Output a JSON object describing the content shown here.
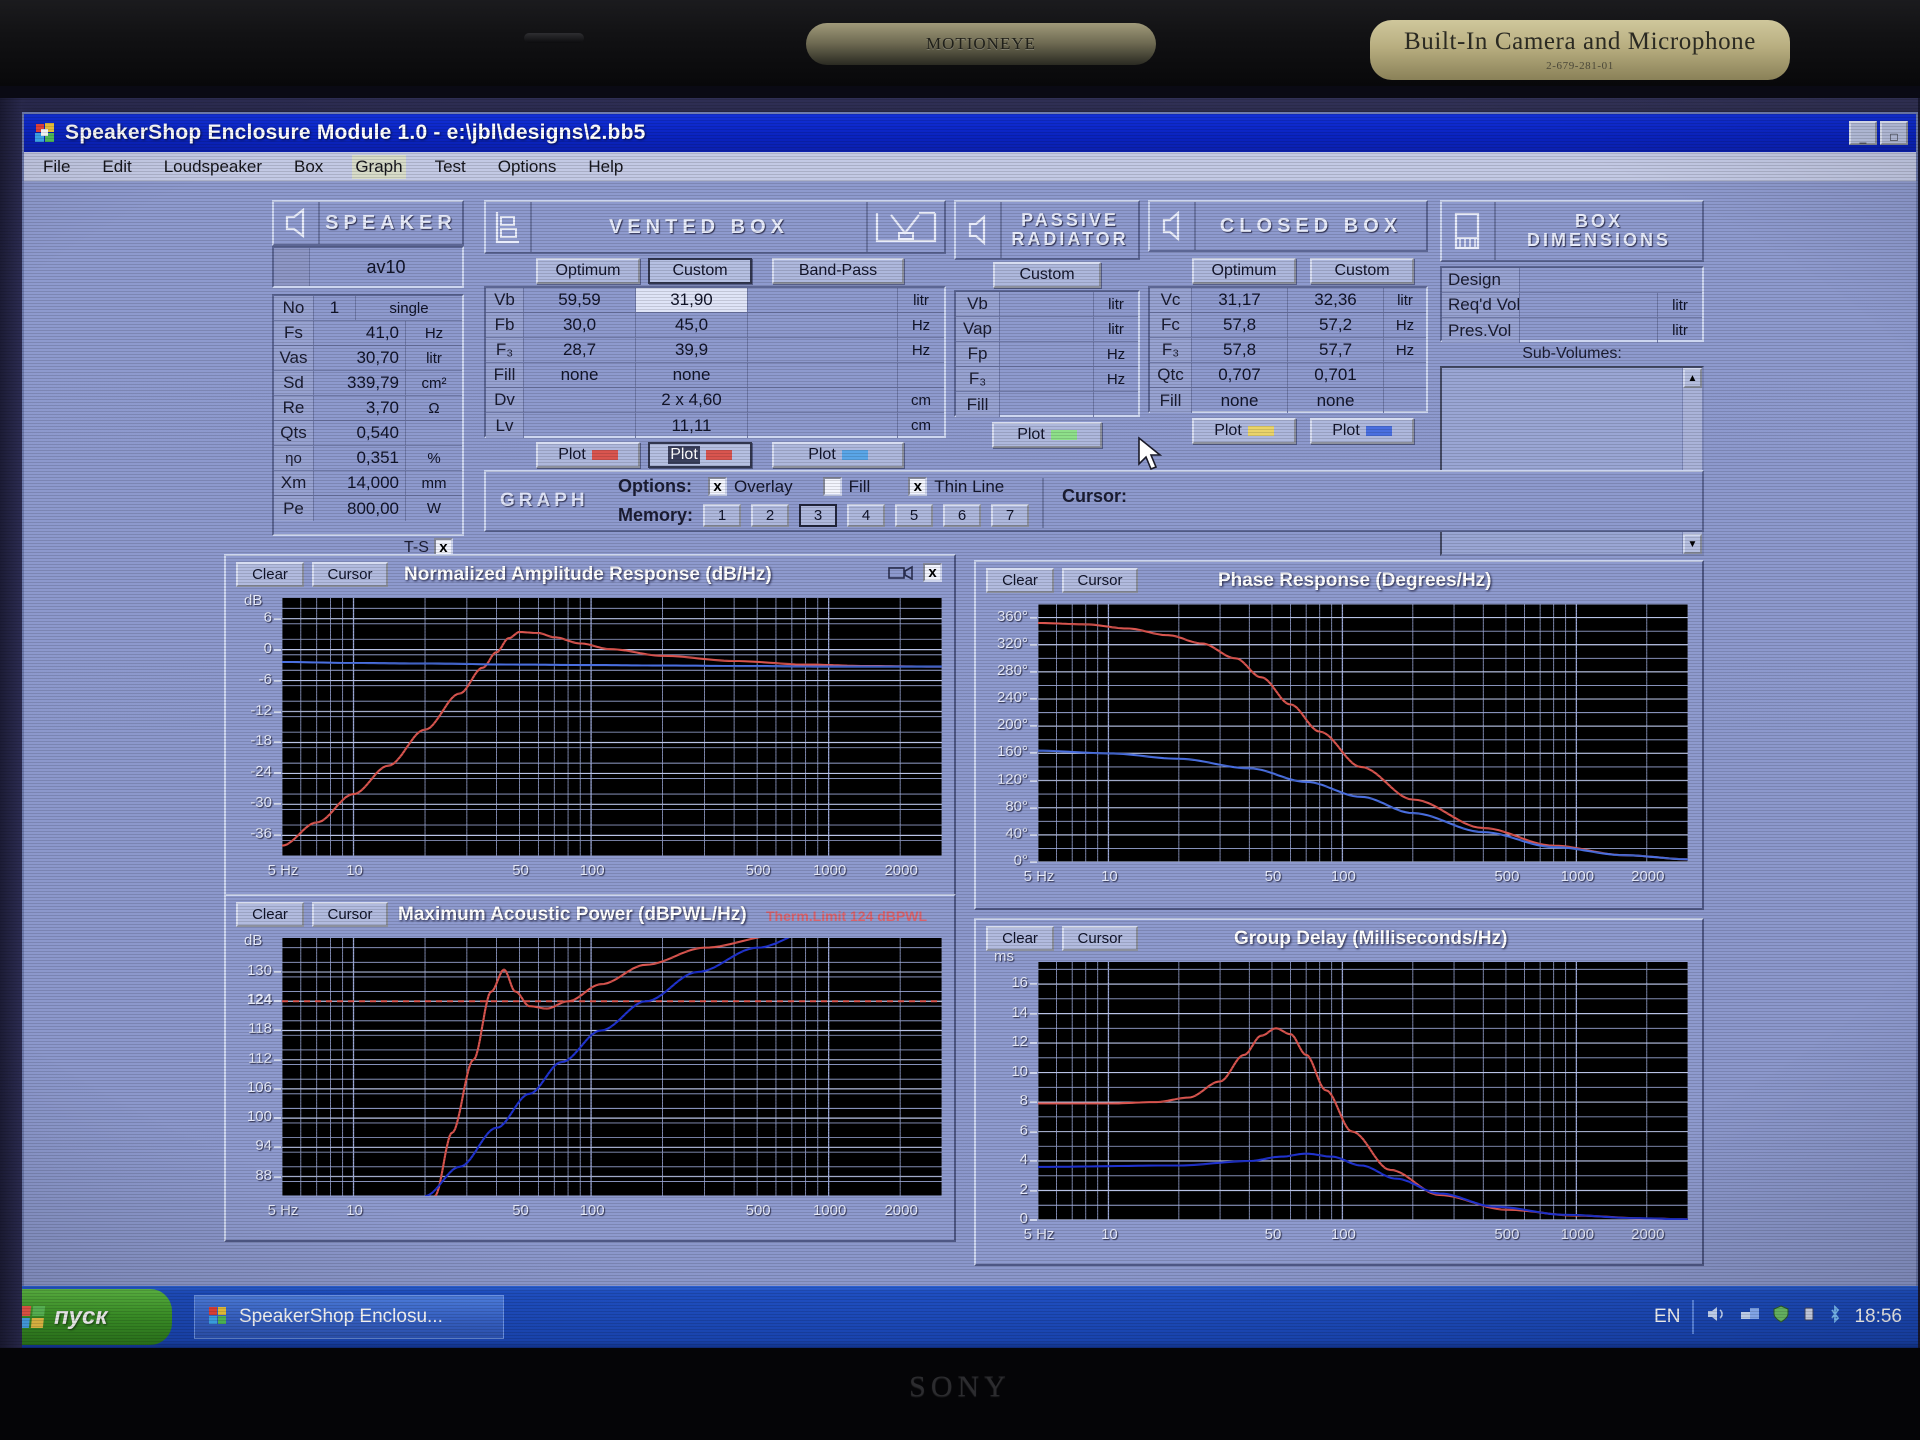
{
  "laptop": {
    "camera_label_left": "MOTIONEYE",
    "camera_label_right": "Built-In Camera and Microphone",
    "camera_label_right_sub": "2-679-281-01",
    "brand": "SONY"
  },
  "window": {
    "title": "SpeakerShop Enclosure Module 1.0 - e:\\jbl\\designs\\2.bb5",
    "buttons": {
      "minimize": "_",
      "maximize": "□"
    },
    "menu": [
      "File",
      "Edit",
      "Loudspeaker",
      "Box",
      "Graph",
      "Test",
      "Options",
      "Help"
    ],
    "menu_active": "Graph"
  },
  "speaker_panel": {
    "header": "SPEAKER",
    "name": "av10",
    "rows": [
      {
        "label": "No",
        "value": "1",
        "unit": "single"
      },
      {
        "label": "Fs",
        "value": "41,0",
        "unit": "Hz"
      },
      {
        "label": "Vas",
        "value": "30,70",
        "unit": "litr"
      },
      {
        "label": "Sd",
        "value": "339,79",
        "unit": "cm²"
      },
      {
        "label": "Re",
        "value": "3,70",
        "unit": "Ω"
      },
      {
        "label": "Qts",
        "value": "0,540",
        "unit": ""
      },
      {
        "label": "ηo",
        "value": "0,351",
        "unit": "%"
      },
      {
        "label": "Xm",
        "value": "14,000",
        "unit": "mm"
      },
      {
        "label": "Pe",
        "value": "800,00",
        "unit": "W"
      }
    ],
    "ts_label": "T-S",
    "ts_checked": "x"
  },
  "vented_box": {
    "header": "VENTED BOX",
    "tabs": [
      "Optimum",
      "Custom",
      "Band-Pass"
    ],
    "active_tab": "Custom",
    "rows": [
      {
        "label": "Vb",
        "optimum": "59,59",
        "custom": "31,90",
        "bandpass": "",
        "unit": "litr"
      },
      {
        "label": "Fb",
        "optimum": "30,0",
        "custom": "45,0",
        "bandpass": "",
        "unit": "Hz"
      },
      {
        "label": "F₃",
        "optimum": "28,7",
        "custom": "39,9",
        "bandpass": "",
        "unit": "Hz"
      },
      {
        "label": "Fill",
        "optimum": "none",
        "custom": "none",
        "bandpass": "",
        "unit": ""
      },
      {
        "label": "Dv",
        "optimum": "",
        "custom": "2 x 4,60",
        "bandpass": "",
        "unit": "cm"
      },
      {
        "label": "Lv",
        "optimum": "",
        "custom": "11,11",
        "bandpass": "",
        "unit": "cm"
      }
    ],
    "plot_label": "Plot",
    "plot_colors": [
      "#d9554f",
      "#d9554f",
      "#5aa6e8"
    ]
  },
  "passive_radiator": {
    "header_line1": "PASSIVE",
    "header_line2": "RADIATOR",
    "tab": "Custom",
    "rows": [
      {
        "label": "Vb",
        "value": "",
        "unit": "litr"
      },
      {
        "label": "Vap",
        "value": "",
        "unit": "litr"
      },
      {
        "label": "Fp",
        "value": "",
        "unit": "Hz"
      },
      {
        "label": "F₃",
        "value": "",
        "unit": "Hz"
      },
      {
        "label": "Fill",
        "value": "",
        "unit": ""
      }
    ],
    "plot_label": "Plot",
    "plot_color": "#8ee08a"
  },
  "closed_box": {
    "header": "CLOSED BOX",
    "tabs": [
      "Optimum",
      "Custom"
    ],
    "rows": [
      {
        "label": "Vc",
        "optimum": "31,17",
        "custom": "32,36",
        "unit": "litr"
      },
      {
        "label": "Fc",
        "optimum": "57,8",
        "custom": "57,2",
        "unit": "Hz"
      },
      {
        "label": "F₃",
        "optimum": "57,8",
        "custom": "57,7",
        "unit": "Hz"
      },
      {
        "label": "Qtc",
        "optimum": "0,707",
        "custom": "0,701",
        "unit": ""
      },
      {
        "label": "Fill",
        "optimum": "none",
        "custom": "none",
        "unit": ""
      }
    ],
    "plot_label": "Plot",
    "plot_colors": [
      "#ead46a",
      "#4a6fe0"
    ]
  },
  "box_dimensions": {
    "header_line1": "BOX",
    "header_line2": "DIMENSIONS",
    "rows": [
      {
        "label": "Design",
        "value": "",
        "unit": ""
      },
      {
        "label": "Req'd Vol",
        "value": "",
        "unit": "litr"
      },
      {
        "label": "Pres.Vol",
        "value": "",
        "unit": "litr"
      }
    ],
    "subvolumes_label": "Sub-Volumes:"
  },
  "graph_options": {
    "word": "GRAPH",
    "options_label": "Options:",
    "memory_label": "Memory:",
    "cursor_label": "Cursor:",
    "checkboxes": [
      {
        "label": "Overlay",
        "checked": true
      },
      {
        "label": "Fill",
        "checked": false
      },
      {
        "label": "Thin Line",
        "checked": true
      }
    ],
    "memory_slots": [
      "1",
      "2",
      "3",
      "4",
      "5",
      "6",
      "7"
    ],
    "memory_selected": "3"
  },
  "charts": [
    {
      "id": "amplitude",
      "title": "Normalized Amplitude Response (dB/Hz)",
      "subtitle": "",
      "buttons": [
        "Clear",
        "Cursor"
      ],
      "unit_label": "dB",
      "yticks": [
        "6",
        "0",
        "-6",
        "-12",
        "-18",
        "-24",
        "-30",
        "-36"
      ],
      "ylim": [
        -40,
        10
      ],
      "xticks": [
        "5 Hz",
        "10",
        "50",
        "100",
        "500",
        "1000",
        "2000"
      ],
      "xlim": [
        5,
        3000
      ],
      "has_camera_icon": true
    },
    {
      "id": "phase",
      "title": "Phase Response (Degrees/Hz)",
      "subtitle": "",
      "buttons": [
        "Clear",
        "Cursor"
      ],
      "unit_label": "",
      "yticks": [
        "360°",
        "320°",
        "280°",
        "240°",
        "200°",
        "160°",
        "120°",
        "80°",
        "40°",
        "0°"
      ],
      "ylim": [
        0,
        380
      ],
      "xticks": [
        "5 Hz",
        "10",
        "50",
        "100",
        "500",
        "1000",
        "2000"
      ],
      "xlim": [
        5,
        3000
      ],
      "has_camera_icon": false
    },
    {
      "id": "power",
      "title": "Maximum Acoustic Power (dBPWL/Hz)",
      "subtitle": "Therm.Limit 124 dBPWL",
      "buttons": [
        "Clear",
        "Cursor"
      ],
      "unit_label": "dB",
      "yticks": [
        "130",
        "124",
        "118",
        "112",
        "106",
        "100",
        "94",
        "88"
      ],
      "ylim": [
        84,
        137
      ],
      "xticks": [
        "5 Hz",
        "10",
        "50",
        "100",
        "500",
        "1000",
        "2000"
      ],
      "xlim": [
        5,
        3000
      ],
      "has_camera_icon": false
    },
    {
      "id": "delay",
      "title": "Group Delay (Milliseconds/Hz)",
      "subtitle": "",
      "buttons": [
        "Clear",
        "Cursor"
      ],
      "unit_label": "ms",
      "yticks": [
        "16",
        "14",
        "12",
        "10",
        "8",
        "6",
        "4",
        "2",
        "0"
      ],
      "ylim": [
        0,
        17.5
      ],
      "xticks": [
        "5 Hz",
        "10",
        "50",
        "100",
        "500",
        "1000",
        "2000"
      ],
      "xlim": [
        5,
        3000
      ],
      "has_camera_icon": false
    }
  ],
  "chart_data": [
    {
      "id": "amplitude",
      "type": "line",
      "title": "Normalized Amplitude Response (dB/Hz)",
      "xlabel": "Hz",
      "ylabel": "dB",
      "xlim": [
        5,
        3000
      ],
      "ylim": [
        -40,
        10
      ],
      "xscale": "log",
      "grid": true,
      "xticks": [
        5,
        10,
        50,
        100,
        500,
        1000,
        2000
      ],
      "yticks": [
        6,
        0,
        -6,
        -12,
        -18,
        -24,
        -30,
        -36
      ],
      "series": [
        {
          "name": "vented-custom",
          "color": "#d9554f",
          "x": [
            5,
            7,
            10,
            14,
            20,
            28,
            35,
            40,
            45,
            50,
            60,
            70,
            90,
            120,
            200,
            400,
            800,
            1500,
            3000
          ],
          "y": [
            -38,
            -33.5,
            -28,
            -22.5,
            -15.5,
            -8.5,
            -3.5,
            -0.5,
            2.2,
            3.4,
            3.2,
            2.4,
            1.2,
            0.1,
            -1.2,
            -2.2,
            -2.9,
            -3.2,
            -3.3
          ]
        },
        {
          "name": "closed-box",
          "color": "#4a6fe0",
          "x": [
            5,
            10,
            20,
            50,
            100,
            200,
            500,
            1000,
            2000,
            3000
          ],
          "y": [
            -2.4,
            -2.6,
            -2.7,
            -2.9,
            -3.0,
            -3.1,
            -3.2,
            -3.3,
            -3.3,
            -3.3
          ]
        }
      ]
    },
    {
      "id": "phase",
      "type": "line",
      "title": "Phase Response (Degrees/Hz)",
      "xlabel": "Hz",
      "ylabel": "Degrees",
      "xlim": [
        5,
        3000
      ],
      "ylim": [
        0,
        380
      ],
      "xscale": "log",
      "grid": true,
      "xticks": [
        5,
        10,
        50,
        100,
        500,
        1000,
        2000
      ],
      "yticks": [
        0,
        40,
        80,
        120,
        160,
        200,
        240,
        280,
        320,
        360
      ],
      "series": [
        {
          "name": "vented-custom",
          "color": "#d9554f",
          "x": [
            5,
            8,
            12,
            18,
            25,
            35,
            45,
            60,
            80,
            120,
            200,
            400,
            800,
            1600,
            3000
          ],
          "y": [
            352,
            350,
            344,
            334,
            322,
            300,
            272,
            232,
            192,
            140,
            92,
            50,
            24,
            10,
            4
          ]
        },
        {
          "name": "closed-box",
          "color": "#4a6fe0",
          "x": [
            5,
            10,
            20,
            40,
            70,
            120,
            200,
            400,
            800,
            1600,
            3000
          ],
          "y": [
            164,
            160,
            152,
            138,
            118,
            96,
            72,
            44,
            22,
            10,
            4
          ]
        }
      ]
    },
    {
      "id": "power",
      "type": "line",
      "title": "Maximum Acoustic Power (dBPWL/Hz)",
      "xlabel": "Hz",
      "ylabel": "dBPWL",
      "xlim": [
        5,
        3000
      ],
      "ylim": [
        84,
        137
      ],
      "xscale": "log",
      "grid": true,
      "xticks": [
        5,
        10,
        50,
        100,
        500,
        1000,
        2000
      ],
      "yticks": [
        130,
        124,
        118,
        112,
        106,
        100,
        94,
        88
      ],
      "annotations": [
        {
          "label": "Therm.Limit 124 dBPWL",
          "y": 124,
          "style": "dashed",
          "color": "#d9554f"
        }
      ],
      "series": [
        {
          "name": "vented-custom",
          "color": "#d9554f",
          "x": [
            22,
            26,
            32,
            38,
            43,
            48,
            55,
            65,
            80,
            110,
            170,
            300,
            600,
            1200,
            2400
          ],
          "y": [
            84,
            97,
            112,
            126,
            130.5,
            126,
            123,
            122.5,
            124,
            127.5,
            131.5,
            135,
            137.5,
            139,
            140
          ]
        },
        {
          "name": "closed-box",
          "color": "#2033d0",
          "x": [
            20,
            28,
            40,
            55,
            75,
            110,
            170,
            280,
            500,
            900,
            1600,
            2600
          ],
          "y": [
            84,
            90,
            98,
            105,
            111.5,
            118,
            124,
            130,
            135,
            139,
            142,
            144
          ]
        }
      ]
    },
    {
      "id": "delay",
      "type": "line",
      "title": "Group Delay (Milliseconds/Hz)",
      "xlabel": "Hz",
      "ylabel": "ms",
      "xlim": [
        5,
        3000
      ],
      "ylim": [
        0,
        17.5
      ],
      "xscale": "log",
      "grid": true,
      "xticks": [
        5,
        10,
        50,
        100,
        500,
        1000,
        2000
      ],
      "yticks": [
        0,
        2,
        4,
        6,
        8,
        10,
        12,
        14,
        16
      ],
      "series": [
        {
          "name": "vented-custom",
          "color": "#d9554f",
          "x": [
            5,
            10,
            16,
            22,
            30,
            38,
            45,
            52,
            60,
            70,
            85,
            110,
            160,
            260,
            500,
            1000,
            2000,
            3000
          ],
          "y": [
            7.9,
            7.9,
            8.0,
            8.3,
            9.4,
            11.2,
            12.5,
            13.0,
            12.6,
            11.2,
            8.8,
            6.0,
            3.4,
            1.7,
            0.7,
            0.3,
            0.1,
            0.05
          ]
        },
        {
          "name": "closed-box",
          "color": "#2033d0",
          "x": [
            5,
            20,
            40,
            55,
            70,
            90,
            120,
            170,
            260,
            450,
            900,
            1800,
            3000
          ],
          "y": [
            3.6,
            3.7,
            4.0,
            4.3,
            4.5,
            4.3,
            3.7,
            2.8,
            1.8,
            0.9,
            0.35,
            0.12,
            0.05
          ]
        }
      ]
    }
  ],
  "taskbar": {
    "start_label": "пуск",
    "task_label": "SpeakerShop Enclosu...",
    "language": "EN",
    "clock": "18:56"
  }
}
